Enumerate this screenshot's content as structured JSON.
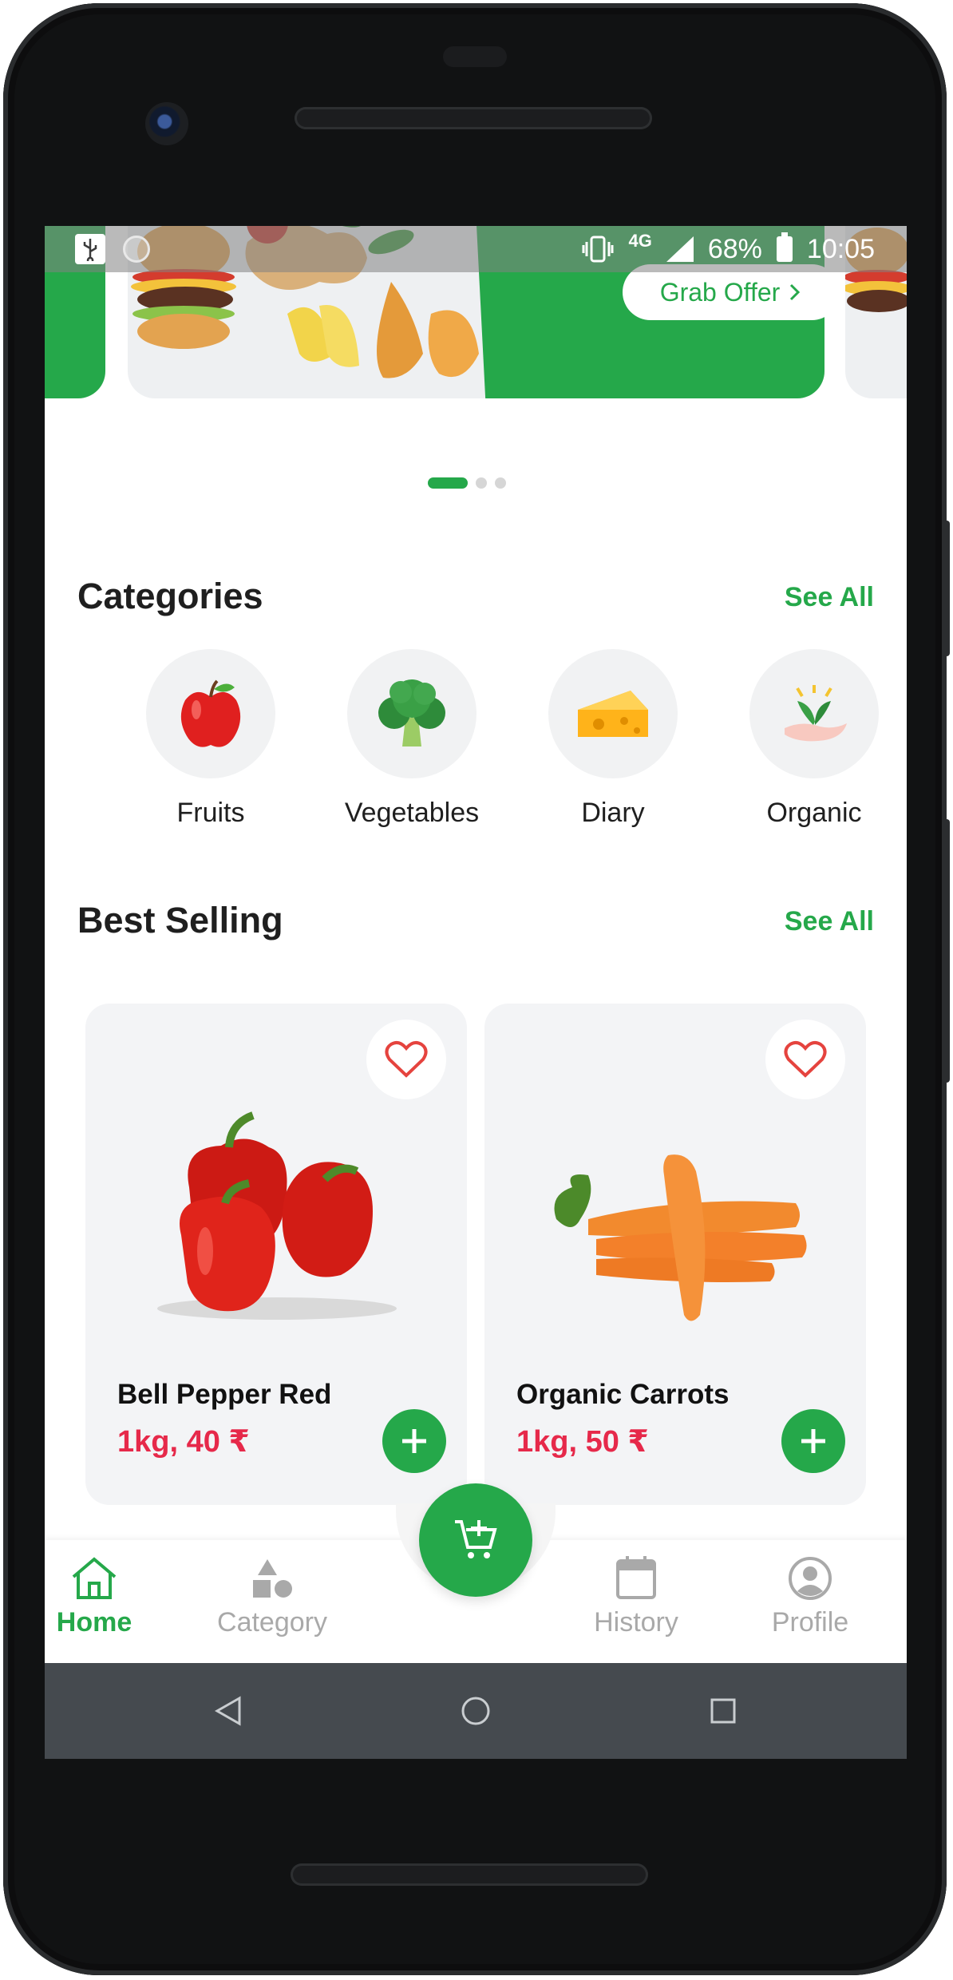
{
  "status_bar": {
    "network": "4G",
    "battery": "68%",
    "time": "10:05"
  },
  "banner": {
    "button_label": "Grab Offer",
    "active_slide": 1,
    "slide_count": 3
  },
  "categories": {
    "title": "Categories",
    "see_all": "See All",
    "items": [
      {
        "label": "Fruits",
        "icon": "apple-icon"
      },
      {
        "label": "Vegetables",
        "icon": "broccoli-icon"
      },
      {
        "label": "Diary",
        "icon": "cheese-icon"
      },
      {
        "label": "Organic",
        "icon": "organic-leaf-icon"
      }
    ]
  },
  "best_selling": {
    "title": "Best Selling",
    "see_all": "See All",
    "products": [
      {
        "name": "Bell Pepper Red",
        "price": "1kg, 40 ₹",
        "image": "bell-pepper-image"
      },
      {
        "name": "Organic Carrots",
        "price": "1kg, 50 ₹",
        "image": "carrots-image"
      }
    ]
  },
  "bottom_nav": {
    "items": [
      {
        "label": "Home",
        "icon": "home-icon",
        "active": true
      },
      {
        "label": "Category",
        "icon": "category-shapes-icon",
        "active": false
      },
      {
        "label": "History",
        "icon": "calendar-icon",
        "active": false
      },
      {
        "label": "Profile",
        "icon": "profile-icon",
        "active": false
      }
    ],
    "fab_icon": "add-to-cart-icon"
  },
  "colors": {
    "brand_green": "#25a84a",
    "price_red": "#e6294a",
    "inactive_gray": "#a9a9a9"
  }
}
